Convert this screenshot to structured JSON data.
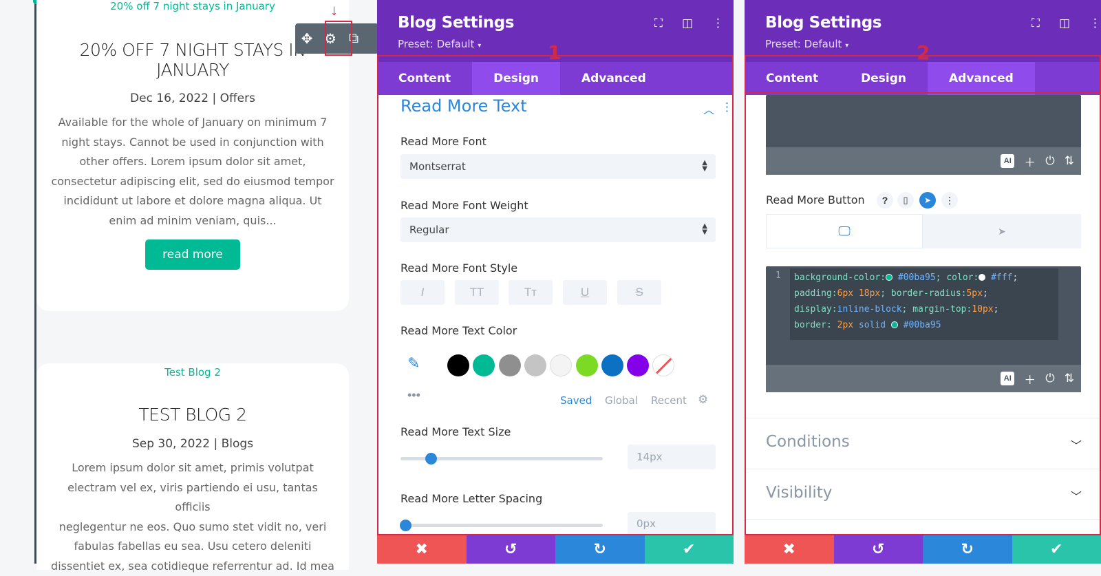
{
  "blog": {
    "post1": {
      "img_alt": "20% off 7 night stays in January",
      "title_line1": "20% OFF 7 NIGHT STAYS IN",
      "title_line2": "JANUARY",
      "meta": "Dec 16, 2022 | Offers",
      "excerpt": [
        "Available for the whole of January on minimum 7",
        "night stays. Cannot be used in conjunction with",
        "other offers. Lorem ipsum dolor sit amet,",
        "consectetur adipiscing elit, sed do eiusmod tempor",
        "incididunt ut labore et dolore magna aliqua. Ut",
        "enim ad minim veniam, quis..."
      ],
      "read_more": "read more"
    },
    "post2": {
      "img_alt": "Test Blog 2",
      "title": "TEST BLOG 2",
      "meta": "Sep 30, 2022 | Blogs",
      "excerpt": [
        "Lorem ipsum dolor sit amet, primis volutpat",
        "electram vel ex, viris partiendo ei usu, tantas officiis",
        "neglegentur ne eos. Quo sumo stet vidit no, veri",
        "fabulas fabellas eu sea. Usu cetero deleniti",
        "dissentiet ex, sea cotidieque referrentur ad. Id mea"
      ]
    },
    "toolbar_icons": [
      "move-icon",
      "gear-icon",
      "duplicate-icon"
    ]
  },
  "panel1": {
    "title": "Blog Settings",
    "preset": "Preset: Default",
    "marker": "1",
    "tabs": [
      "Content",
      "Design",
      "Advanced"
    ],
    "active_tab": "Design",
    "section_title": "Read More Text",
    "font_label": "Read More Font",
    "font_value": "Montserrat",
    "weight_label": "Read More Font Weight",
    "weight_value": "Regular",
    "style_label": "Read More Font Style",
    "style_buttons": [
      "I",
      "TT",
      "Tт",
      "U",
      "S"
    ],
    "color_label": "Read More Text Color",
    "swatches": [
      "#000000",
      "#00ba95",
      "#8f8f8f",
      "#c4c4c4",
      "#f4f4f4",
      "#7cda24",
      "#0c71c3",
      "#8300e9"
    ],
    "color_tabs": [
      "Saved",
      "Global",
      "Recent"
    ],
    "size_label": "Read More Text Size",
    "size_value": "14px",
    "spacing_label": "Read More Letter Spacing",
    "spacing_value": "0px"
  },
  "panel2": {
    "title": "Blog Settings",
    "preset": "Preset: Default",
    "marker": "2",
    "tabs": [
      "Content",
      "Design",
      "Advanced"
    ],
    "active_tab": "Advanced",
    "button_label": "Read More Button",
    "code_line_number": "1",
    "code": {
      "l1a": "background-color:",
      "l1b": "#00ba95",
      "l1c": "; color:",
      "l1d": "#fff",
      "l1e": ";",
      "l2a": "padding:",
      "l2b": "6px 18px",
      "l2c": "; border-radius:",
      "l2d": "5px",
      "l2e": ";",
      "l3a": "display:",
      "l3b": "inline-block",
      "l3c": "; margin-top:",
      "l3d": "10px",
      "l3e": ";",
      "l4a": "border: ",
      "l4b": "2px",
      "l4c": " solid ",
      "l4d": "#00ba95"
    },
    "conditions": "Conditions",
    "visibility": "Visibility",
    "ai_label": "AI"
  },
  "colors": {
    "purple_header": "#6c2eb9",
    "purple_tabs": "#7d3bd3",
    "teal": "#00ba95",
    "red": "#ef5555",
    "blue": "#2b87da",
    "green": "#29c4a9",
    "highlight": "#d12a48"
  }
}
